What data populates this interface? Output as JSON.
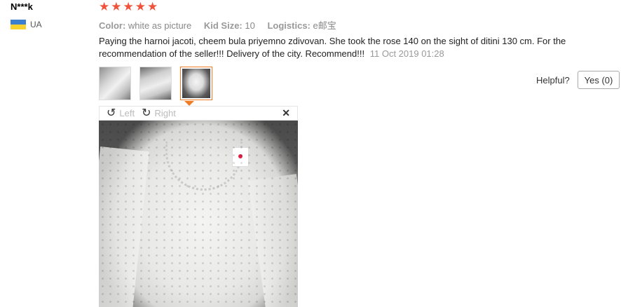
{
  "reviewer": {
    "name": "N***k",
    "country_code": "UA",
    "flag_colors": [
      "#3b7fd0",
      "#f6d22f"
    ]
  },
  "rating": {
    "stars": 5,
    "max": 5,
    "star_color": "#f0523b"
  },
  "attributes": [
    {
      "key": "Color:",
      "value": "white as picture"
    },
    {
      "key": "Kid Size:",
      "value": "10"
    },
    {
      "key": "Logistics:",
      "value": "e邮宝"
    }
  ],
  "review": {
    "text": "Paying the harnoi jacoti, cheem bula priyemno zdivovan. She took the rose 140 on the sight of ditini 130 cm. For the recommendation of the seller!!! Delivery of the city. Recommend!!!",
    "date": "11 Oct 2019 01:28"
  },
  "helpful": {
    "label": "Helpful?",
    "yes_label": "Yes (0)"
  },
  "viewer": {
    "left_label": "Left",
    "right_label": "Right",
    "close_glyph": "✕",
    "rotate_left_icon": "↺",
    "rotate_right_icon": "↻"
  },
  "accent_color": "#f07b24"
}
